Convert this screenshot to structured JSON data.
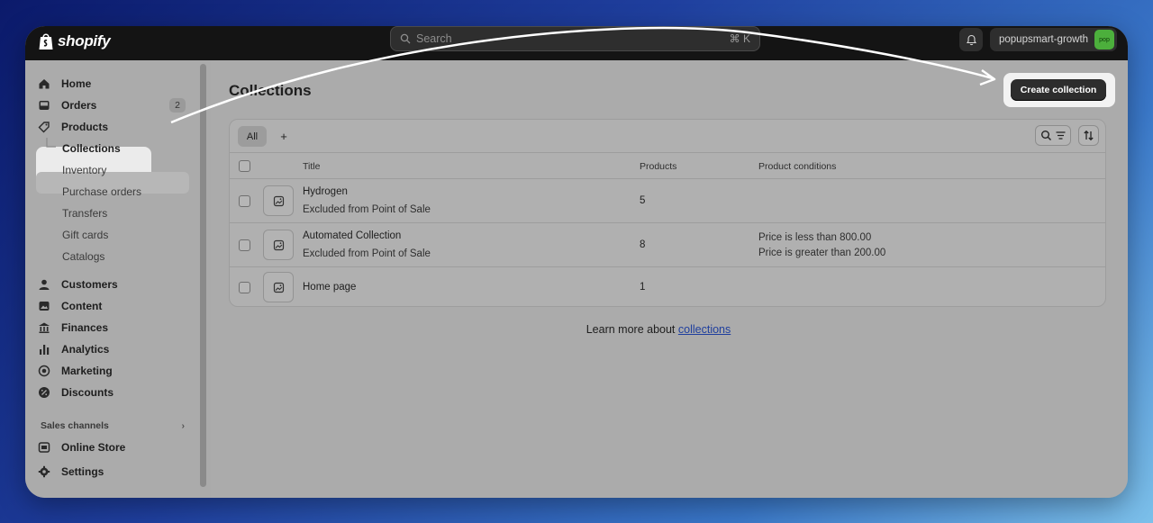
{
  "topbar": {
    "logo_text": "shopify",
    "search_placeholder": "Search",
    "search_shortcut": "⌘ K",
    "store_name": "popupsmart-growth",
    "avatar_text": "pop"
  },
  "sidebar": {
    "home": "Home",
    "orders": "Orders",
    "orders_badge": "2",
    "products": "Products",
    "collections": "Collections",
    "inventory": "Inventory",
    "purchase_orders": "Purchase orders",
    "transfers": "Transfers",
    "gift_cards": "Gift cards",
    "catalogs": "Catalogs",
    "customers": "Customers",
    "content": "Content",
    "finances": "Finances",
    "analytics": "Analytics",
    "marketing": "Marketing",
    "discounts": "Discounts",
    "sales_channels": "Sales channels",
    "online_store": "Online Store",
    "settings": "Settings"
  },
  "main": {
    "title": "Collections",
    "create_button": "Create collection",
    "tab_all": "All",
    "tab_add": "+",
    "columns": {
      "title": "Title",
      "products": "Products",
      "conditions": "Product conditions"
    },
    "rows": [
      {
        "title": "Hydrogen",
        "subtitle": "Excluded from Point of Sale",
        "products": "5",
        "condition1": "",
        "condition2": ""
      },
      {
        "title": "Automated Collection",
        "subtitle": "Excluded from Point of Sale",
        "products": "8",
        "condition1": "Price is less than 800.00",
        "condition2": "Price is greater than 200.00"
      },
      {
        "title": "Home page",
        "subtitle": "",
        "products": "1",
        "condition1": "",
        "condition2": ""
      }
    ],
    "learn_more_prefix": "Learn more about ",
    "learn_more_link": "collections"
  },
  "colors": {
    "topbar": "#141414",
    "accent_green": "#4caf3c",
    "link": "#1f3f9e"
  }
}
